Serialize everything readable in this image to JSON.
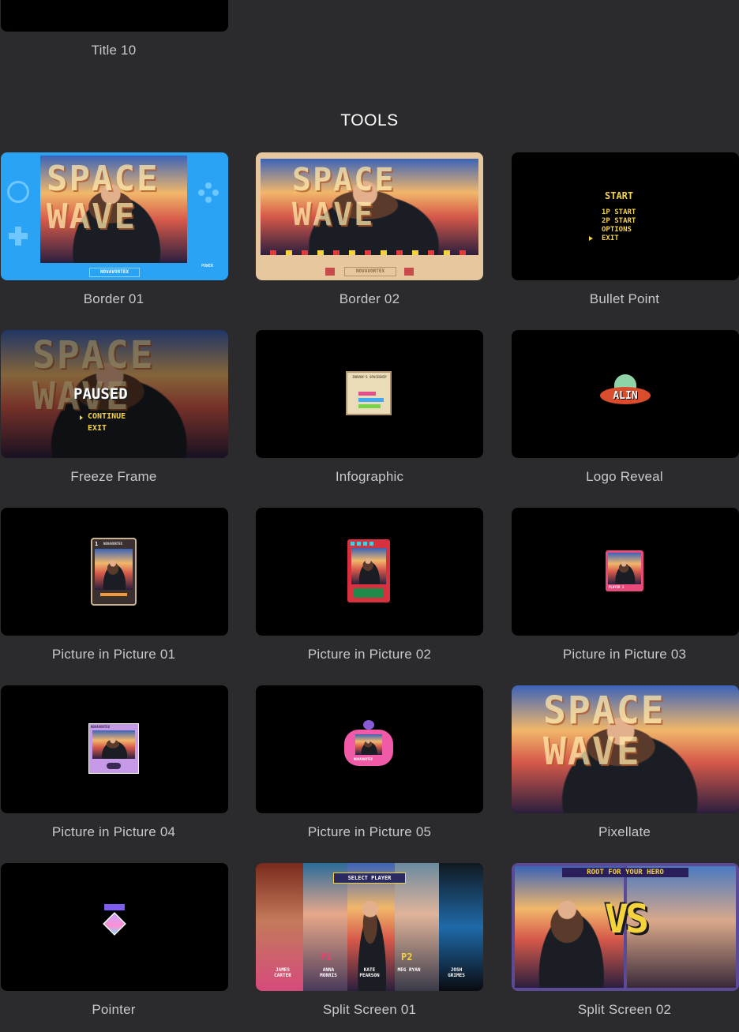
{
  "previous_item": {
    "label": "Title 10"
  },
  "section": {
    "title": "TOOLS"
  },
  "items": [
    {
      "label": "Border 01"
    },
    {
      "label": "Border 02"
    },
    {
      "label": "Bullet Point"
    },
    {
      "label": "Freeze Frame"
    },
    {
      "label": "Infographic"
    },
    {
      "label": "Logo Reveal"
    },
    {
      "label": "Picture in Picture 01"
    },
    {
      "label": "Picture in Picture 02"
    },
    {
      "label": "Picture in Picture 03"
    },
    {
      "label": "Picture in Picture 04"
    },
    {
      "label": "Picture in Picture 05"
    },
    {
      "label": "Pixellate"
    },
    {
      "label": "Pointer"
    },
    {
      "label": "Split Screen 01"
    },
    {
      "label": "Split Screen 02"
    }
  ],
  "thumb_text": {
    "photo_word_1": "SPACE",
    "photo_word_2": "WAVE",
    "border01_logo": "NOVAVORTEX",
    "border01_power": "POWER",
    "border02_logo": "NOVAVORTEX",
    "bullet_menu": [
      "START",
      "1P START",
      "2P START",
      "OPTIONS",
      "EXIT"
    ],
    "freeze_title": "PAUSED",
    "freeze_options": [
      "CONTINUE",
      "EXIT"
    ],
    "infographic_title": "ZARVOX'S SPACESHIP",
    "logo_reveal_text": "ALIN",
    "pip01_header": "NOVAVORTEX",
    "pip01_number": "1",
    "pip03_caption": "PLAYER 1",
    "pip04_header": "NOVAVORTEX",
    "pip05_caption": "NOVAVORTEX",
    "split01_header": "SELECT PLAYER",
    "split01_p1": "P1",
    "split01_p2": "P2",
    "split01_names": [
      "JAMES CARTER",
      "ANNA MORRIS",
      "KATE PEARSON",
      "MEG RYAN",
      "JOSH GRIMES"
    ],
    "split02_header": "ROOT FOR YOUR HERO",
    "split02_vs": "VS"
  },
  "colors": {
    "background": "#2b2b2d",
    "border01_blue": "#2aa3f5",
    "border02_tan": "#e7c79e",
    "menu_yellow": "#f3d34a",
    "pip02_red": "#d7313f",
    "pip03_pink": "#e84a7c",
    "pip04_lavender": "#c69ae6",
    "pip05_pink": "#f05aa6",
    "split_yellow": "#f4d33c"
  }
}
